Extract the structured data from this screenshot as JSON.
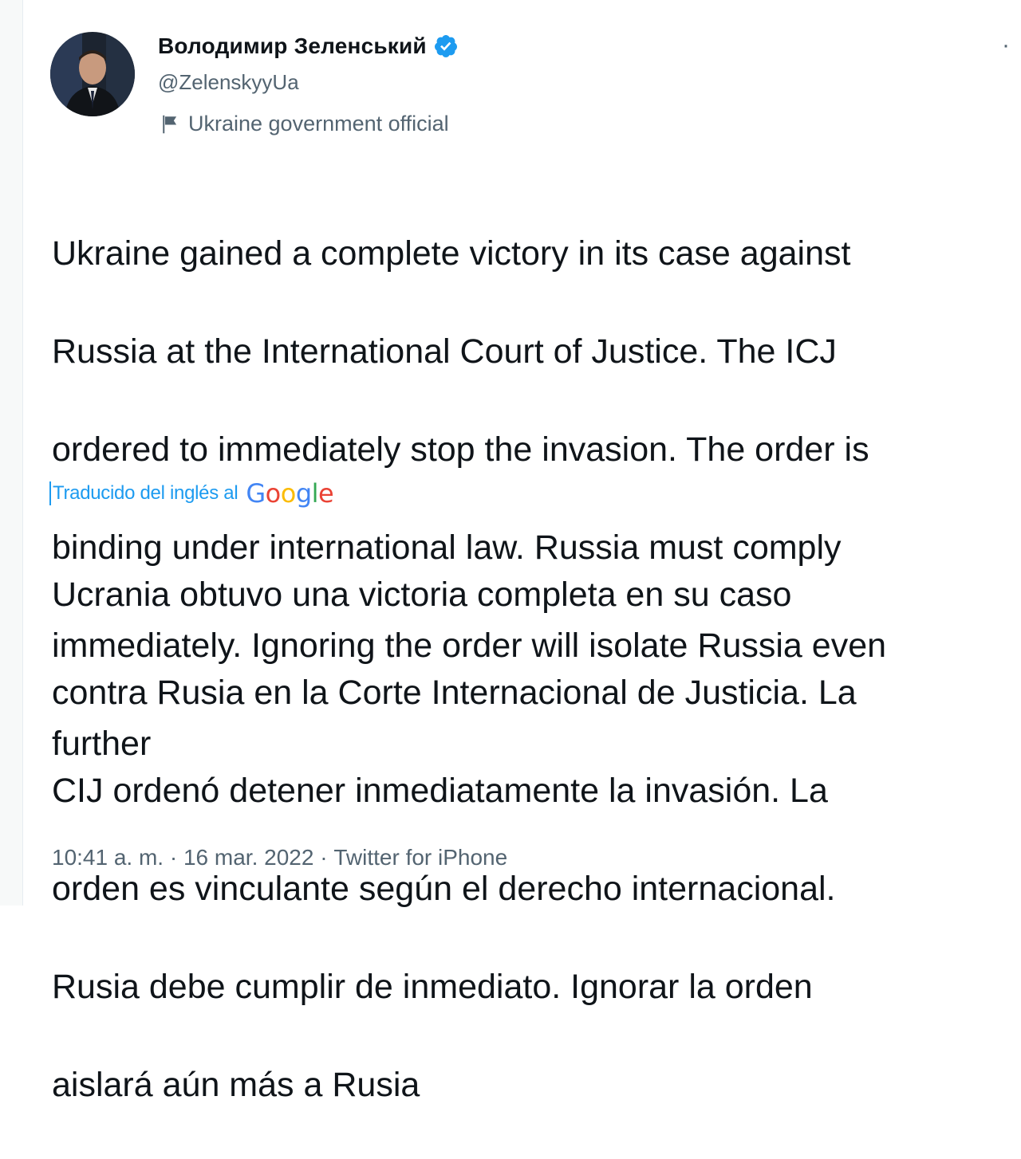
{
  "tweet": {
    "author": {
      "display_name": "Володимир Зеленський",
      "handle": "@ZelenskyyUa",
      "label": "Ukraine government official",
      "verified_icon": "verified-badge-icon",
      "label_icon": "flag-icon"
    },
    "more_icon": "more-options-icon",
    "text_lines": [
      "Ukraine gained a complete victory in its case against",
      "Russia at the International Court of Justice. The ICJ",
      "ordered to immediately stop the invasion. The order is",
      "binding under international law.  Russia must comply",
      "immediately. Ignoring the order will isolate Russia even",
      "further"
    ],
    "translation": {
      "label": "Traducido del inglés al",
      "provider": "Google",
      "text_lines": [
        "Ucrania obtuvo una victoria completa en su caso",
        "contra Rusia en la Corte Internacional de Justicia. La",
        "CIJ ordenó detener inmediatamente la invasión. La",
        "orden es vinculante según el derecho internacional.",
        "Rusia debe cumplir de inmediato. Ignorar la orden",
        "aislará aún más a Rusia"
      ]
    },
    "meta": {
      "time": "10:41 a. m.",
      "separator": " · ",
      "date": "16 mar. 2022",
      "source": "Twitter for iPhone"
    }
  },
  "colors": {
    "text_primary": "#0f1419",
    "text_secondary": "#536471",
    "accent": "#1d9bf0"
  }
}
